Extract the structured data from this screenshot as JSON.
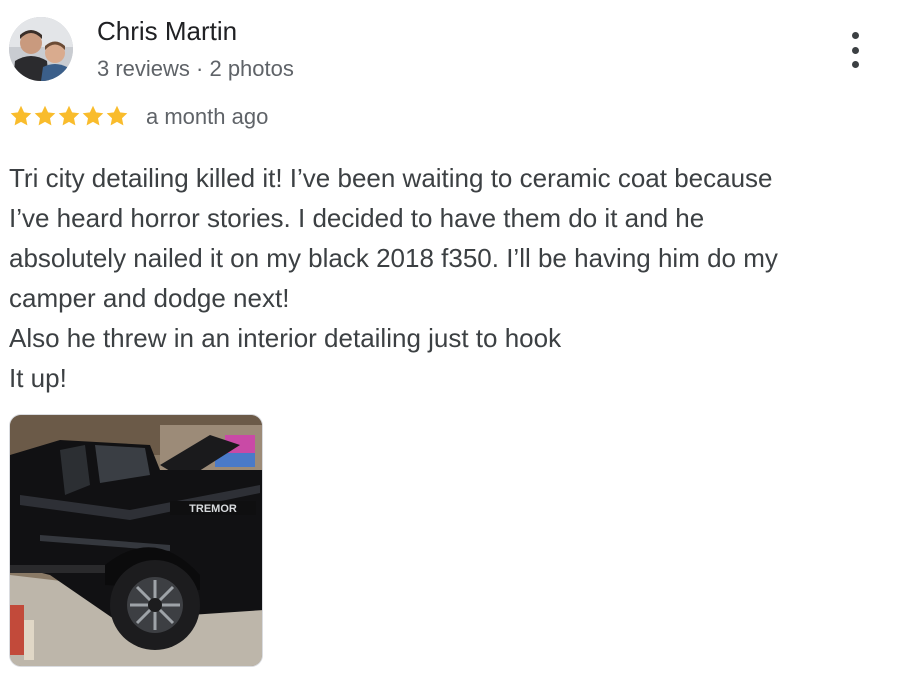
{
  "reviewer": {
    "name": "Chris Martin",
    "meta": "3 reviews · 2 photos"
  },
  "rating": {
    "stars": 5,
    "max": 5,
    "star_color": "#f9bc2c",
    "time_ago": "a month ago"
  },
  "review": {
    "lines": [
      "Tri city detailing killed it! I’ve been waiting to ceramic coat because",
      "I’ve heard horror stories. I decided to have them do it and he",
      "absolutely nailed it on my black 2018 f350. I’ll be having him do my",
      "camper and dodge next!",
      "Also he threw in an interior detailing just to hook",
      "It up!"
    ]
  },
  "photo": {
    "badge_text": "TREMOR"
  },
  "icons": {
    "menu": "more-vert-icon",
    "star": "star-icon"
  }
}
